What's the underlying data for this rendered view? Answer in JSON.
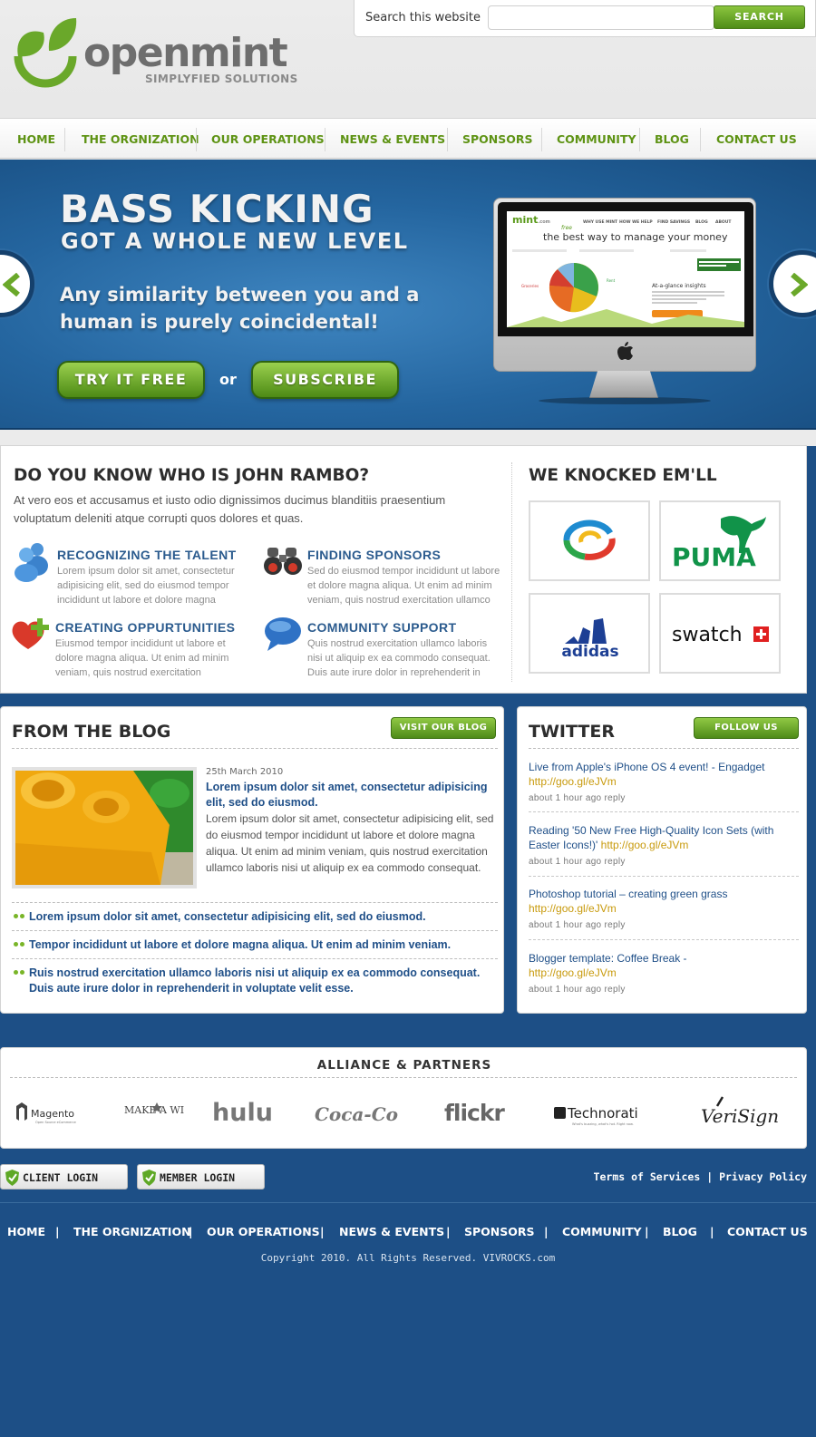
{
  "brand": {
    "name": "openmint",
    "tagline": "SIMPLYFIED SOLUTIONS"
  },
  "search": {
    "label": "Search this website",
    "placeholder": "",
    "button": "SEARCH"
  },
  "nav": [
    "HOME",
    "THE ORGNIZATION",
    "OUR OPERATIONS",
    "NEWS & EVENTS",
    "SPONSORS",
    "COMMUNITY",
    "BLOG",
    "CONTACT US"
  ],
  "hero": {
    "title": "BASS KICKING",
    "subtitle": "GOT A WHOLE NEW LEVEL",
    "description": "Any similarity between you and a human is purely coincidental!",
    "cta_primary": "TRY IT FREE",
    "or": "or",
    "cta_secondary": "SUBSCRIBE",
    "screen": {
      "logo": "mint",
      "logo_suffix": ".com",
      "menu": [
        "WHY USE MINT",
        "HOW WE HELP",
        "FIND SAVINGS",
        "BLOG",
        "ABOUT"
      ],
      "tagline": "the best way to manage your money",
      "free": "free"
    }
  },
  "about": {
    "title": "DO YOU KNOW WHO IS JOHN RAMBO?",
    "intro": "At vero eos et accusamus et iusto odio dignissimos ducimus blanditiis praesentium voluptatum deleniti atque corrupti quos dolores et quas.",
    "features": [
      {
        "title": "RECOGNIZING THE TALENT",
        "text": "Lorem ipsum dolor sit amet, consectetur adipisicing elit, sed do eiusmod tempor incididunt ut labore et dolore magna",
        "icon": "users-icon"
      },
      {
        "title": "FINDING SPONSORS",
        "text": "Sed do eiusmod tempor incididunt ut labore et dolore magna aliqua. Ut enim ad minim veniam, quis nostrud exercitation ullamco",
        "icon": "binoculars-icon"
      },
      {
        "title": "CREATING OPPURTUNITIES",
        "text": "Eiusmod tempor incididunt ut labore et dolore magna aliqua. Ut enim ad minim veniam, quis nostrud exercitation",
        "icon": "heart-plus-icon"
      },
      {
        "title": "COMMUNITY SUPPORT",
        "text": "Quis nostrud exercitation ullamco laboris nisi ut aliquip ex ea commodo consequat. Duis aute irure dolor in reprehenderit in",
        "icon": "speech-bubble-icon"
      }
    ]
  },
  "knocked": {
    "title": "WE KNOCKED EM'LL",
    "logos": [
      "ring-logo",
      "PUMA",
      "adidas",
      "swatch"
    ]
  },
  "blog": {
    "title": "FROM THE BLOG",
    "button": "VISIT OUR BLOG",
    "post": {
      "date": "25th March 2010",
      "headline": "Lorem ipsum dolor sit amet, consectetur adipisicing elit, sed do eiusmod.",
      "body": "Lorem ipsum dolor sit amet, consectetur adipisicing elit, sed do eiusmod tempor incididunt ut labore et dolore magna aliqua. Ut enim ad minim veniam, quis nostrud exercitation ullamco laboris nisi ut aliquip ex ea commodo consequat."
    },
    "links": [
      "Lorem ipsum dolor sit amet, consectetur adipisicing elit, sed do eiusmod.",
      "Tempor incididunt ut labore et dolore magna aliqua. Ut enim ad minim veniam.",
      "Ruis nostrud exercitation ullamco laboris nisi ut aliquip ex ea commodo consequat. Duis aute irure dolor in reprehenderit in voluptate velit esse."
    ]
  },
  "twitter": {
    "title": "TWITTER",
    "button": "FOLLOW US",
    "tweets": [
      {
        "text": "Live from Apple's iPhone OS 4 event! - Engadget",
        "link": "http://goo.gl/eJVm",
        "meta": "about 1 hour ago reply"
      },
      {
        "text": "Reading '50 New Free High-Quality Icon Sets (with Easter Icons!)'",
        "link": "http://goo.gl/eJVm",
        "meta": "about 1 hour ago reply"
      },
      {
        "text": "Photoshop tutorial – creating green grass",
        "link": "http://goo.gl/eJVm",
        "meta": "about 1 hour ago reply"
      },
      {
        "text": "Blogger template: Coffee Break -",
        "link": "http://goo.gl/eJVm",
        "meta": "about 1 hour ago reply"
      }
    ]
  },
  "partners": {
    "title": "ALLIANCE & PARTNERS",
    "names": [
      "Magento",
      "MAKE A WISH",
      "hulu",
      "Coca-Cola",
      "flickr",
      "Technorati",
      "VeriSign"
    ],
    "magento_sub": "Open Source eCommerce",
    "technorati_sub": "What's buzzing, what's hot. Right now."
  },
  "footer": {
    "client_login": "CLIENT LOGIN",
    "member_login": "MEMBER LOGIN",
    "terms": "Terms of Services",
    "legal_sep": "|",
    "privacy": "Privacy Policy",
    "nav": [
      "HOME",
      "THE ORGNIZATION",
      "OUR OPERATIONS",
      "NEWS & EVENTS",
      "SPONSORS",
      "COMMUNITY",
      "BLOG",
      "CONTACT US"
    ],
    "copyright": "Copyright 2010. All Rights Reserved. VIVROCKS.com"
  },
  "colors": {
    "green": "#6aa82a",
    "blue": "#1f4f88",
    "nav_text": "#5e9314",
    "link": "#c89a0c"
  }
}
